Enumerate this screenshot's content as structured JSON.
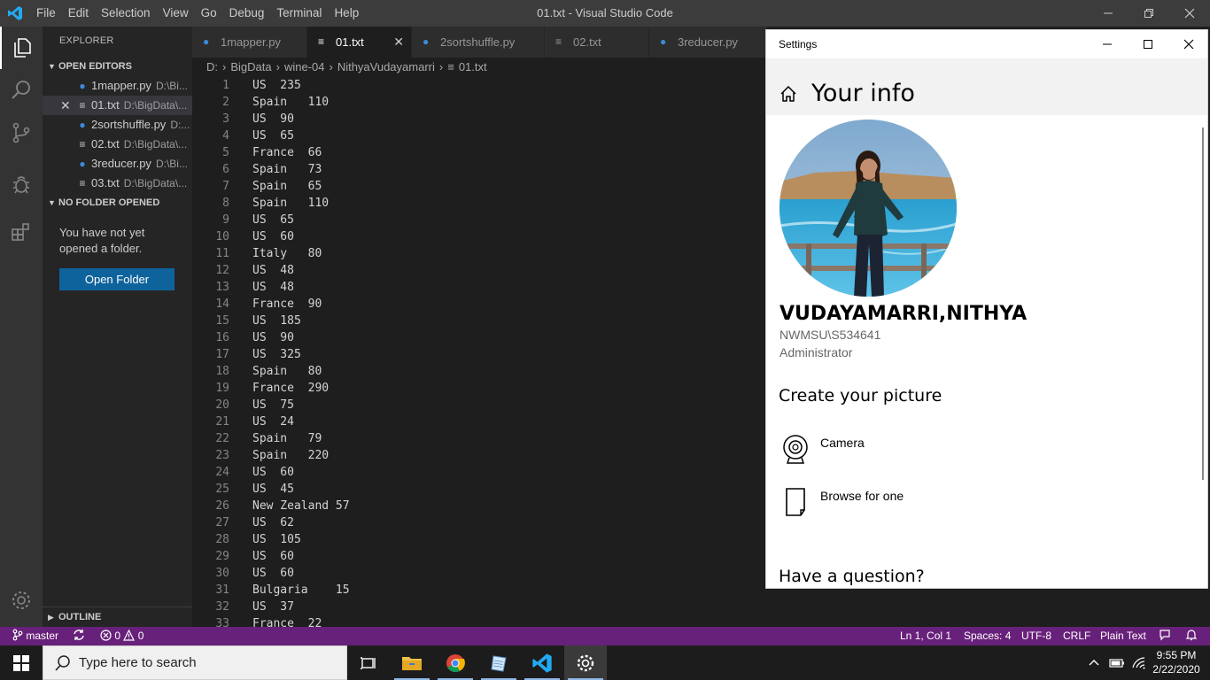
{
  "window": {
    "title": "01.txt - Visual Studio Code",
    "menu": [
      "File",
      "Edit",
      "Selection",
      "View",
      "Go",
      "Debug",
      "Terminal",
      "Help"
    ]
  },
  "sidebar": {
    "title": "EXPLORER",
    "open_editors_label": "OPEN EDITORS",
    "open_editors": [
      {
        "name": "1mapper.py",
        "path": "D:\\Bi...",
        "type": "py"
      },
      {
        "name": "01.txt",
        "path": "D:\\BigData\\...",
        "type": "txt",
        "selected": true
      },
      {
        "name": "2sortshuffle.py",
        "path": "D:...",
        "type": "py"
      },
      {
        "name": "02.txt",
        "path": "D:\\BigData\\...",
        "type": "txt"
      },
      {
        "name": "3reducer.py",
        "path": "D:\\Bi...",
        "type": "py"
      },
      {
        "name": "03.txt",
        "path": "D:\\BigData\\...",
        "type": "txt"
      }
    ],
    "no_folder_label": "NO FOLDER OPENED",
    "no_folder_text": "You have not yet opened a folder.",
    "open_folder_button": "Open Folder",
    "outline_label": "OUTLINE"
  },
  "tabs": [
    {
      "label": "1mapper.py",
      "type": "py"
    },
    {
      "label": "01.txt",
      "type": "txt",
      "active": true
    },
    {
      "label": "2sortshuffle.py",
      "type": "py"
    },
    {
      "label": "02.txt",
      "type": "txt"
    },
    {
      "label": "3reducer.py",
      "type": "py"
    }
  ],
  "breadcrumb": [
    "D:",
    "BigData",
    "wine-04",
    "NithyaVudayamarri",
    "01.txt"
  ],
  "editor": {
    "lines": [
      "US  235",
      "Spain   110",
      "US  90",
      "US  65",
      "France  66",
      "Spain   73",
      "Spain   65",
      "Spain   110",
      "US  65",
      "US  60",
      "Italy   80",
      "US  48",
      "US  48",
      "France  90",
      "US  185",
      "US  90",
      "US  325",
      "Spain   80",
      "France  290",
      "US  75",
      "US  24",
      "Spain   79",
      "Spain   220",
      "US  60",
      "US  45",
      "New Zealand 57",
      "US  62",
      "US  105",
      "US  60",
      "US  60",
      "Bulgaria    15",
      "US  37",
      "France  22"
    ]
  },
  "settings": {
    "window_title": "Settings",
    "heading": "Your info",
    "user_name": "VUDAYAMARRI,NITHYA",
    "account": "NWMSU\\S534641",
    "role": "Administrator",
    "create_picture": "Create your picture",
    "camera": "Camera",
    "browse": "Browse for one",
    "question": "Have a question?"
  },
  "statusbar": {
    "branch": "master",
    "errors": "0",
    "warnings": "0",
    "position": "Ln 1, Col 1",
    "spaces": "Spaces: 4",
    "encoding": "UTF-8",
    "eol": "CRLF",
    "language": "Plain Text",
    "accent_color": "#68217a"
  },
  "taskbar": {
    "search_placeholder": "Type here to search",
    "time": "9:55 PM",
    "date": "2/22/2020"
  }
}
